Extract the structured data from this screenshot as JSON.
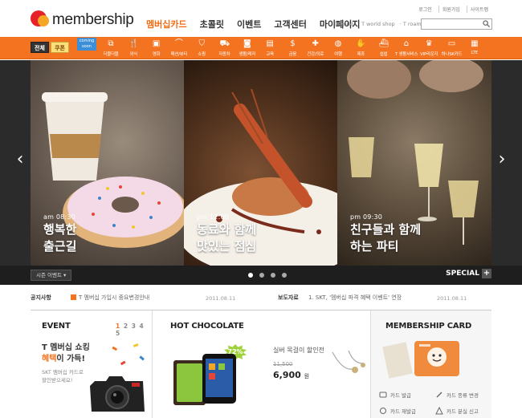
{
  "header": {
    "logo_text": "membership",
    "nav": [
      "멤버십카드",
      "초콜릿",
      "이벤트",
      "고객센터",
      "마이페이지"
    ],
    "nav_active": "멤버십카드",
    "tworld_links": [
      "T world",
      "· T world shop",
      "· T roaming"
    ],
    "util_links": [
      "로그인",
      "회원가입",
      "사이트맵"
    ],
    "search_placeholder": ""
  },
  "category_bar": {
    "all_label": "전체",
    "coupon_label": "쿠폰",
    "new_badge": "coming soon",
    "items": [
      {
        "label": "더블더블",
        "icon": "double-icon"
      },
      {
        "label": "외식",
        "icon": "fork-knife-icon"
      },
      {
        "label": "영화",
        "icon": "film-icon"
      },
      {
        "label": "패션/뷰티",
        "icon": "hanger-icon"
      },
      {
        "label": "쇼핑",
        "icon": "shopping-bag-icon"
      },
      {
        "label": "자동차",
        "icon": "car-icon"
      },
      {
        "label": "생활/레저",
        "icon": "camera-icon"
      },
      {
        "label": "교육",
        "icon": "book-icon"
      },
      {
        "label": "금융",
        "icon": "dollar-icon"
      },
      {
        "label": "건강/의료",
        "icon": "medical-cross-icon"
      },
      {
        "label": "여행",
        "icon": "globe-icon"
      },
      {
        "label": "제휴",
        "icon": "handshake-icon"
      },
      {
        "label": "쉽쉽",
        "icon": "ship-icon"
      },
      {
        "label": "T 생활서비스",
        "icon": "home-icon"
      },
      {
        "label": "VIP라운지",
        "icon": "crown-icon"
      },
      {
        "label": "하나SK카드",
        "icon": "card-icon"
      },
      {
        "label": "LTE",
        "icon": "grid-icon"
      }
    ]
  },
  "hero": {
    "slides": [
      {
        "time": "am 08:30",
        "title_line1": "행복한",
        "title_line2": "출근길"
      },
      {
        "time": "pm 12:00",
        "title_line1": "동료와 함께",
        "title_line2": "맛있는 점심"
      },
      {
        "time": "pm 09:30",
        "title_line1": "친구들과 함께",
        "title_line2": "하는 파티"
      }
    ],
    "season_label": "시즌 이벤트",
    "special_label": "SPECIAL",
    "page_dots": 4
  },
  "notice": {
    "notice_label": "공지사항",
    "notice_text": "T 멤버십 가입시 중요변경안내",
    "notice_date": "2011.08.11",
    "press_label": "보도자료",
    "press_text": "1. SKT, '멤버십 파격 혜택 이벤트' 연장",
    "press_date": "2011.08.11"
  },
  "event_card": {
    "title": "EVENT",
    "pages": [
      "1",
      "2",
      "3",
      "4",
      "5"
    ],
    "active_page": "1",
    "line1": "T 멤버십 쇼킹",
    "line2_orange": "혜택",
    "line2_rest": "이 가득!",
    "sub1": "SKT 멤버십 카드로",
    "sub2": "할인받으세요!"
  },
  "hot_chocolate": {
    "title": "HOT CHOCOLATE",
    "discount_badge": "72%",
    "product_name": "실버 목걸이 할인전",
    "old_price": "11,500",
    "new_price": "6,900",
    "currency": "원"
  },
  "membership_card": {
    "title": "MEMBERSHIP CARD",
    "links": [
      "카드 발급",
      "카드 종류 변경",
      "카드 재발급",
      "카드 분실 신고"
    ]
  },
  "colors": {
    "accent": "#f37321",
    "dark": "#1e1e1e",
    "badge_green": "#9fd23a"
  }
}
